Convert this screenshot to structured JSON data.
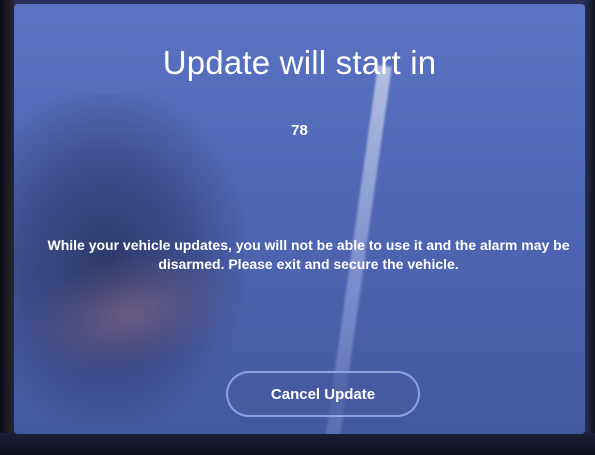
{
  "dialog": {
    "title": "Update will start in",
    "countdown": "78",
    "message": "While your vehicle updates, you will not be able to use it and the alarm may be disarmed. Please exit and secure the vehicle.",
    "cancel_label": "Cancel Update"
  },
  "colors": {
    "screen_background": "#5069b8",
    "text": "#ffffff",
    "button_border": "#96afeb"
  }
}
